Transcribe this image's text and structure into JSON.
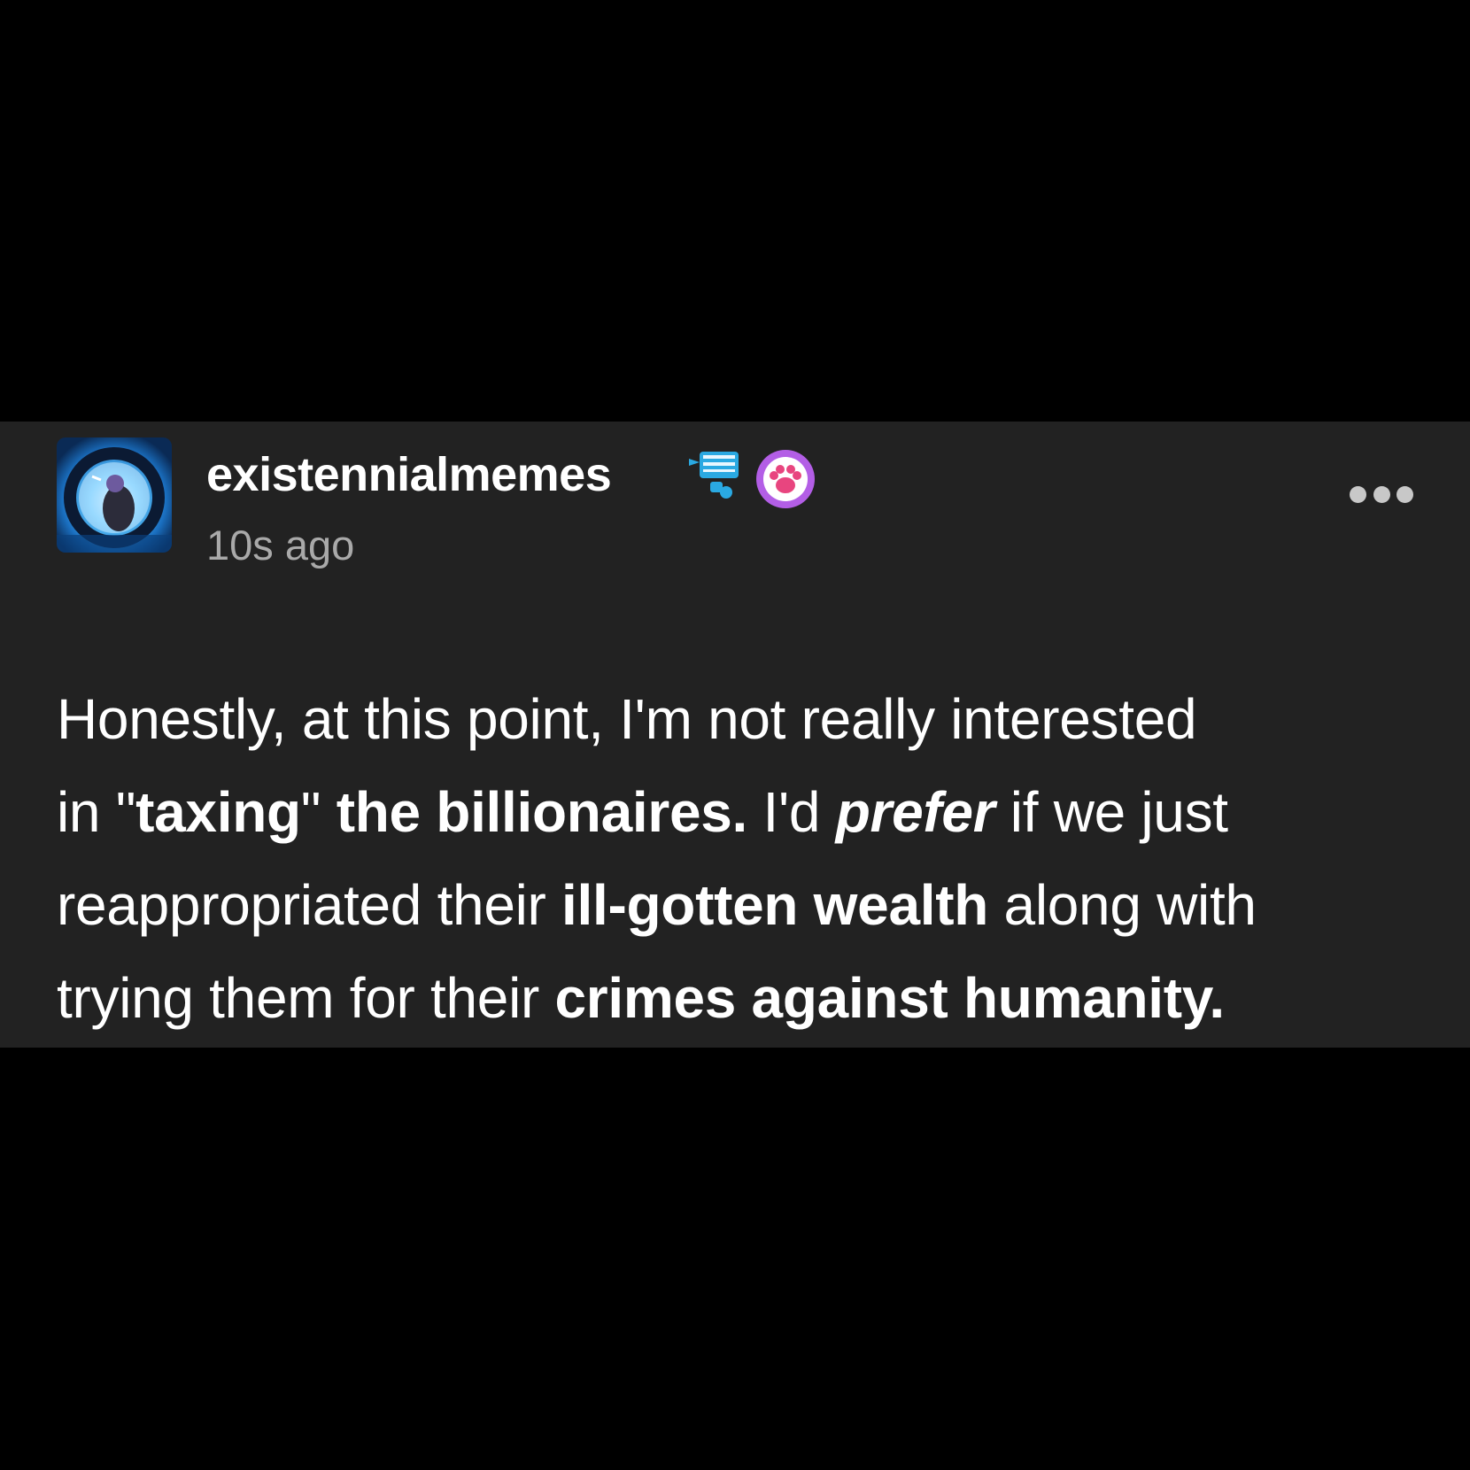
{
  "post": {
    "author": {
      "username": "existennialmemes",
      "avatar_icon": "avatar-image",
      "badges": [
        "tape-dispenser-badge-icon",
        "paw-badge-icon"
      ]
    },
    "timestamp": "10s ago",
    "more_icon": "more-options-icon",
    "body": {
      "line1": {
        "t1": "Honestly, at this point, I'm not really interested"
      },
      "line2": {
        "t1": "in \"",
        "b1": "taxing",
        "t2": "\" ",
        "b2": "the billionaires.",
        "t3": " I'd ",
        "i1": "prefer",
        "t4": " if we just"
      },
      "line3": {
        "t1": "reappropriated their ",
        "b1": "ill-gotten wealth",
        "t2": " along with"
      },
      "line4": {
        "t1": "trying them for their ",
        "b1": "crimes against humanity."
      }
    }
  },
  "colors": {
    "page_background": "#000000",
    "card_background": "#222222",
    "text_primary": "#ffffff",
    "text_secondary": "#a9a9a9",
    "paw_badge": "#b35ee6",
    "paw_pink": "#e8457f",
    "tape_blue": "#29a8e0"
  }
}
